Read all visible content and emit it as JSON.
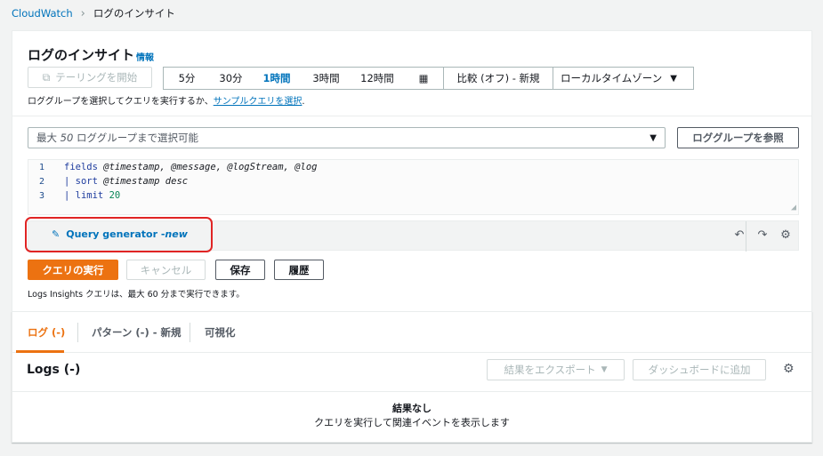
{
  "breadcrumb": {
    "root": "CloudWatch",
    "current": "ログのインサイト"
  },
  "header": {
    "title": "ログのインサイト",
    "info": "情報"
  },
  "toolbar": {
    "tail_label": "テーリングを開始",
    "time_ranges": [
      "5分",
      "30分",
      "1時間",
      "3時間",
      "12時間"
    ],
    "active_range": "1時間",
    "compare_label": "比較 (オフ) - 新規",
    "timezone_label": "ローカルタイムゾーン"
  },
  "hint": {
    "text": "ロググループを選択してクエリを実行するか、",
    "link": "サンプルクエリを選択",
    "suffix": "."
  },
  "log_group_select": {
    "placeholder_prefix": "最大 ",
    "placeholder_num": "50",
    "placeholder_suffix": " ロググループまで選択可能",
    "browse_label": "ロググループを参照"
  },
  "editor": {
    "lines": [
      {
        "no": "1",
        "kw": "fields",
        "rest": " @timestamp, @message, @logStream, @log"
      },
      {
        "no": "2",
        "kw": "| sort",
        "rest": " @timestamp desc"
      },
      {
        "no": "3",
        "kw": "| limit",
        "rest": " 20"
      }
    ]
  },
  "query_generator": {
    "label": "Query generator - ",
    "badge": "new"
  },
  "actions": {
    "run": "クエリの実行",
    "cancel": "キャンセル",
    "save": "保存",
    "history": "履歴",
    "note": "Logs Insights クエリは、最大 60 分まで実行できます。"
  },
  "tabs": {
    "logs": "ログ (-)",
    "patterns": "パターン (-) - 新規",
    "visualize": "可視化"
  },
  "results": {
    "title": "Logs (-)",
    "export": "結果をエクスポート",
    "add_dashboard": "ダッシュボードに追加",
    "empty_title": "結果なし",
    "empty_desc": "クエリを実行して関連イベントを表示します"
  },
  "colors": {
    "accent": "#ec7211",
    "link": "#0073bb",
    "highlight": "#e02424"
  }
}
